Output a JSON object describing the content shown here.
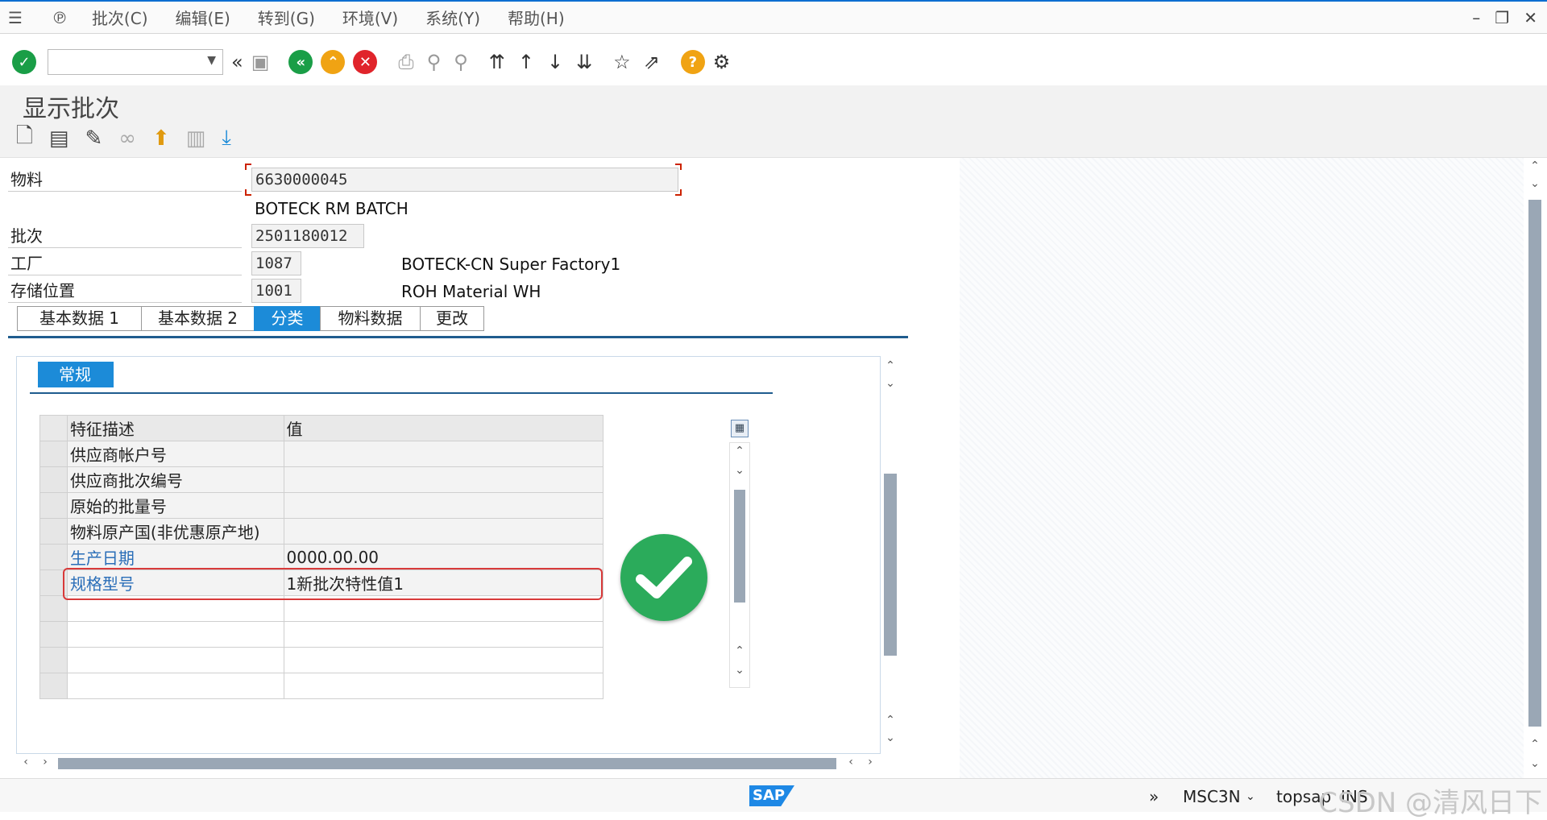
{
  "menu": {
    "items": [
      "批次(C)",
      "编辑(E)",
      "转到(G)",
      "环境(V)",
      "系统(Y)",
      "帮助(H)"
    ]
  },
  "title": "显示批次",
  "fields": {
    "material_label": "物料",
    "material_value": "6630000045",
    "material_desc": "BOTECK RM BATCH",
    "batch_label": "批次",
    "batch_value": "2501180012",
    "plant_label": "工厂",
    "plant_value": "1087",
    "plant_desc": "BOTECK-CN Super Factory1",
    "sloc_label": "存储位置",
    "sloc_value": "1001",
    "sloc_desc": "ROH Material WH"
  },
  "tabs": [
    {
      "label": "基本数据 1",
      "active": false
    },
    {
      "label": "基本数据 2",
      "active": false
    },
    {
      "label": "分类",
      "active": true
    },
    {
      "label": "物料数据",
      "active": false
    },
    {
      "label": "更改",
      "active": false
    }
  ],
  "subtab": "常规",
  "table": {
    "headers": [
      "特征描述",
      "值"
    ],
    "rows": [
      {
        "desc": "供应商帐户号",
        "value": ""
      },
      {
        "desc": "供应商批次编号",
        "value": ""
      },
      {
        "desc": "原始的批量号",
        "value": ""
      },
      {
        "desc": "物料原产国(非优惠原产地)",
        "value": ""
      },
      {
        "desc": "生产日期",
        "value": "0000.00.00"
      },
      {
        "desc": "规格型号",
        "value": "1新批次特性值1"
      }
    ]
  },
  "status": {
    "sap": "SAP",
    "tcode": "MSC3N",
    "server": "topsap",
    "mode": "INS",
    "watermark": "CSDN @清风日下"
  },
  "colors": {
    "accent": "#1c8bd8",
    "success": "#2bab5b",
    "highlight": "#d83a3a"
  }
}
